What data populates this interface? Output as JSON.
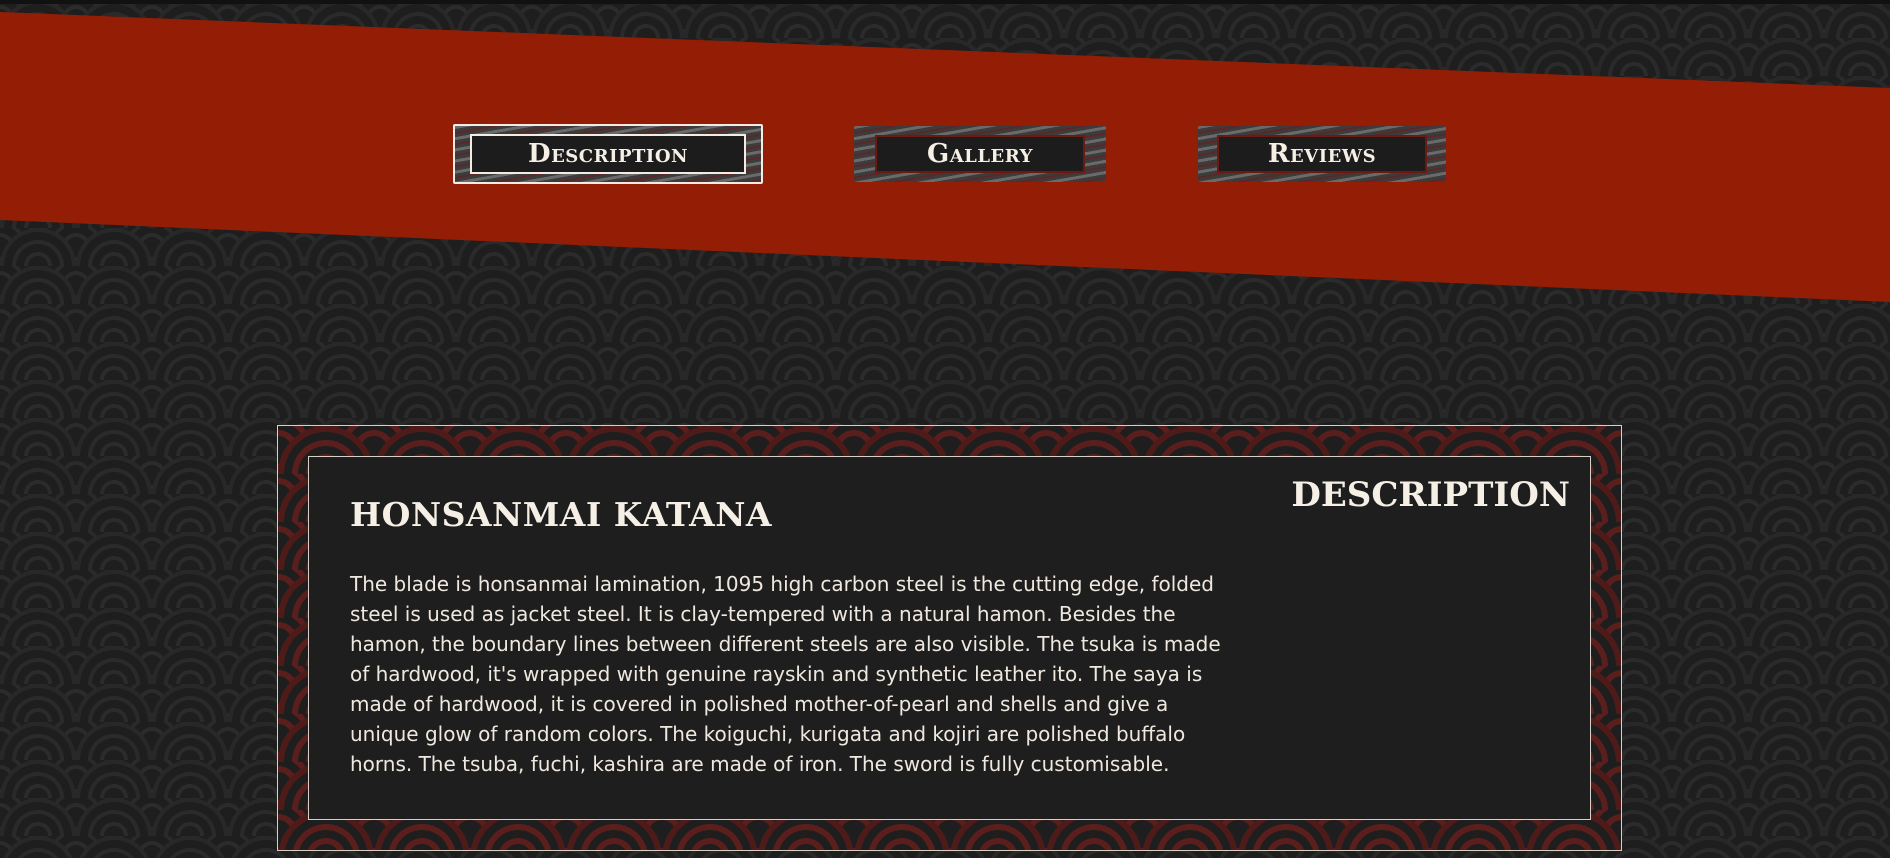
{
  "tabs": [
    {
      "label": "Description",
      "active": true
    },
    {
      "label": "Gallery",
      "active": false
    },
    {
      "label": "Reviews",
      "active": false
    }
  ],
  "product": {
    "title": "HONSANMAI KATANA",
    "section_label": "DESCRIPTION",
    "description": "The blade is honsanmai lamination, 1095 high carbon steel is the cutting edge, folded steel is used as jacket steel. It is clay-tempered with a natural hamon. Besides the hamon, the boundary lines between different steels are also visible. The tsuka is made of hardwood, it's wrapped with genuine rayskin and synthetic leather ito. The saya is made of hardwood, it is covered in polished mother-of-pearl and shells and give a unique glow of random colors. The koiguchi, kurigata and kojiri are polished buffalo horns. The tsuba, fuchi, kashira are made of iron. The sword is fully customisable."
  },
  "colors": {
    "banner": "#941e05",
    "background": "#1e1e1e",
    "panel_pattern": "#5a1e1c",
    "text": "#f5efe6"
  }
}
